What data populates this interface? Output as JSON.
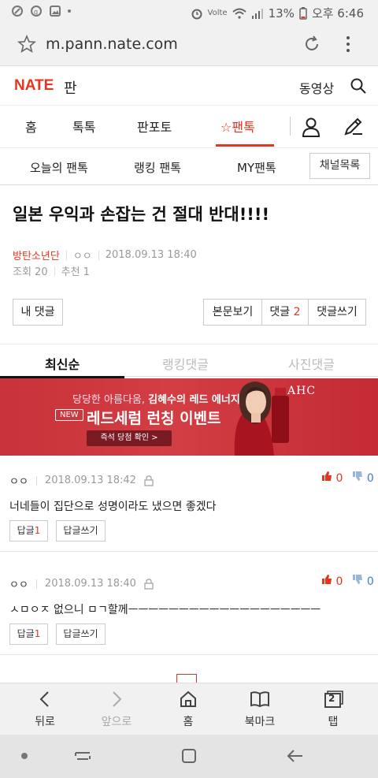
{
  "status": {
    "time": "오후 6:46",
    "battery": "13%",
    "net": "Volte"
  },
  "browser": {
    "url": "m.pann.nate.com"
  },
  "header": {
    "logo": "NATE",
    "section": "판",
    "video": "동영상"
  },
  "nav": {
    "items": [
      "홈",
      "톡톡",
      "판포토",
      "☆팬톡"
    ]
  },
  "subnav": {
    "items": [
      "오늘의 팬톡",
      "랭킹 팬톡",
      "MY팬톡"
    ],
    "channel_list": "채널목록"
  },
  "article": {
    "title": "일본 우익과 손잡는 건 절대 반대!!!!",
    "author": "방탄소년단",
    "nick": "ㅇㅇ",
    "date": "2018.09.13 18:40",
    "views": "조회 20",
    "recommend": "추천 1"
  },
  "actions": {
    "my_comments": "내 댓글",
    "view_body": "본문보기",
    "comments_label": "댓글",
    "comments_count": "2",
    "write_comment": "댓글쓰기"
  },
  "comment_tabs": [
    "최신순",
    "랭킹댓글",
    "사진댓글"
  ],
  "ad": {
    "line1_pre": "당당한 아름다움, ",
    "line1_bold": "김혜수의 레드 에너지",
    "badge": "NEW",
    "line2": "레드세럼 런칭 이벤트",
    "cta": "즉석 당첨 확인 >",
    "brand": "AHC"
  },
  "comments": [
    {
      "nick": "ㅇㅇ",
      "date": "2018.09.13 18:42",
      "up": "0",
      "down": "0",
      "text": "너네들이 집단으로 성명이라도 냈으면 좋겠다",
      "reply_label": "답글",
      "reply_count": "1",
      "write_reply": "답글쓰기"
    },
    {
      "nick": "ㅇㅇ",
      "date": "2018.09.13 18:40",
      "up": "0",
      "down": "0",
      "text": "ㅅㅁㅇㅈ 없으니 ㅁㄱ할께ㅡㅡㅡㅡㅡㅡㅡㅡㅡㅡㅡㅡㅡㅡㅡㅡㅡㅡㅡ",
      "reply_label": "답글",
      "reply_count": "1",
      "write_reply": "답글쓰기"
    }
  ],
  "toolbar": {
    "back": "뒤로",
    "forward": "앞으로",
    "home": "홈",
    "bookmark": "북마크",
    "tabs": "탭",
    "tab_count": "2"
  },
  "colors": {
    "accent": "#e8331e",
    "ad_bg": "#c8323a"
  }
}
